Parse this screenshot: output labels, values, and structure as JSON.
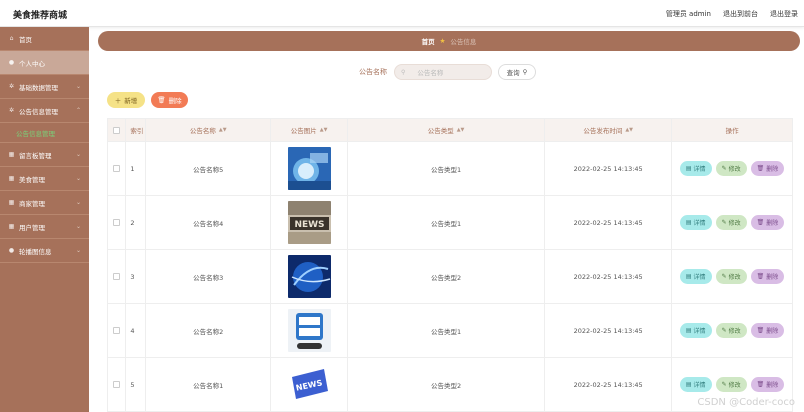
{
  "app": {
    "title": "美食推荐商城"
  },
  "topbar": {
    "admin": "管理员 admin",
    "front": "退出到前台",
    "logout": "退出登录"
  },
  "sidebar": {
    "items": [
      {
        "label": "首页",
        "icon": "home-icon"
      },
      {
        "label": "个人中心",
        "icon": "user-icon"
      },
      {
        "label": "基础数据管理",
        "icon": "gear-icon"
      },
      {
        "label": "公告信息管理",
        "icon": "gear-icon"
      },
      {
        "label": "留言板管理",
        "icon": "grid-icon"
      },
      {
        "label": "美食管理",
        "icon": "grid-icon"
      },
      {
        "label": "商家管理",
        "icon": "grid-icon"
      },
      {
        "label": "用户管理",
        "icon": "grid-icon"
      },
      {
        "label": "轮播图信息",
        "icon": "user-icon"
      }
    ],
    "sub": "公告信息管理"
  },
  "breadcrumb": {
    "home": "首页",
    "current": "公告信息"
  },
  "search": {
    "label": "公告名称",
    "placeholder": "公告名称",
    "button": "查询"
  },
  "actions": {
    "add": "新增",
    "delete": "删除"
  },
  "table": {
    "headers": {
      "index": "索引",
      "name": "公告名称",
      "image": "公告图片",
      "type": "公告类型",
      "time": "公告发布时间",
      "ops": "操作"
    },
    "op_labels": {
      "detail": "详情",
      "edit": "修改",
      "delete": "删除"
    },
    "rows": [
      {
        "index": "1",
        "name": "公告名称5",
        "type": "公告类型1",
        "time": "2022-02-25 14:13:45",
        "image": "news-globe-thumbnail"
      },
      {
        "index": "2",
        "name": "公告名称4",
        "type": "公告类型1",
        "time": "2022-02-25 14:13:45",
        "image": "news-sign-thumbnail"
      },
      {
        "index": "3",
        "name": "公告名称3",
        "type": "公告类型2",
        "time": "2022-02-25 14:13:45",
        "image": "blue-globe-thumbnail"
      },
      {
        "index": "4",
        "name": "公告名称2",
        "type": "公告类型1",
        "time": "2022-02-25 14:13:45",
        "image": "hot-news-thumbnail"
      },
      {
        "index": "5",
        "name": "公告名称1",
        "type": "公告类型2",
        "time": "2022-02-25 14:13:45",
        "image": "news-key-thumbnail"
      }
    ]
  },
  "watermark": "CSDN @Coder-coco",
  "colors": {
    "sidebar": "#a6715a",
    "accent_green": "#7ad17a",
    "delete": "#f27b55",
    "add": "#f5e287"
  }
}
